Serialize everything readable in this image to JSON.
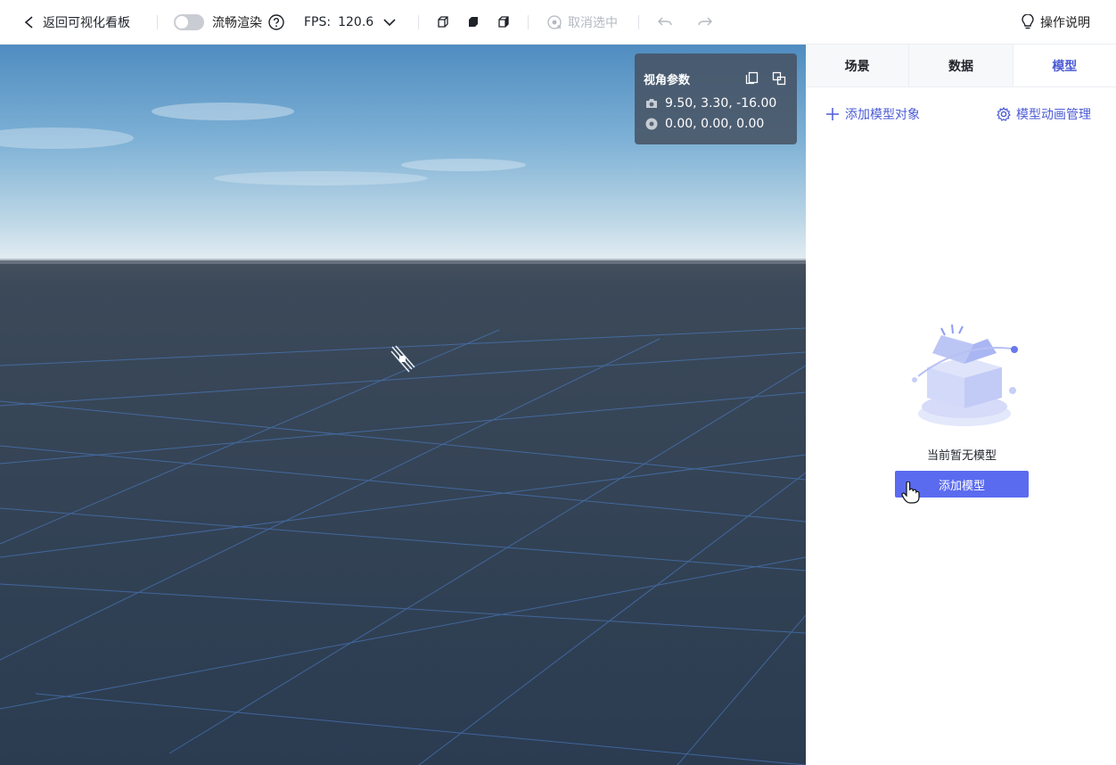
{
  "toolbar": {
    "back_label": "返回可视化看板",
    "smooth_render_label": "流畅渲染",
    "smooth_render_on": false,
    "fps_label": "FPS:",
    "fps_value": "120.6",
    "deselect_label": "取消选中",
    "help_label": "操作说明"
  },
  "camera_panel": {
    "title": "视角参数",
    "position": "9.50, 3.30, -16.00",
    "target": "0.00, 0.00, 0.00"
  },
  "side_panel": {
    "tabs": [
      {
        "label": "场景",
        "active": false
      },
      {
        "label": "数据",
        "active": false
      },
      {
        "label": "模型",
        "active": true
      }
    ],
    "add_object_label": "添加模型对象",
    "animation_manage_label": "模型动画管理",
    "empty_text": "当前暂无模型",
    "add_model_button": "添加模型"
  },
  "colors": {
    "accent": "#5b6bf0",
    "link": "#4b5bd6",
    "ground": "#2f4156",
    "grid": "#4f86d8"
  }
}
